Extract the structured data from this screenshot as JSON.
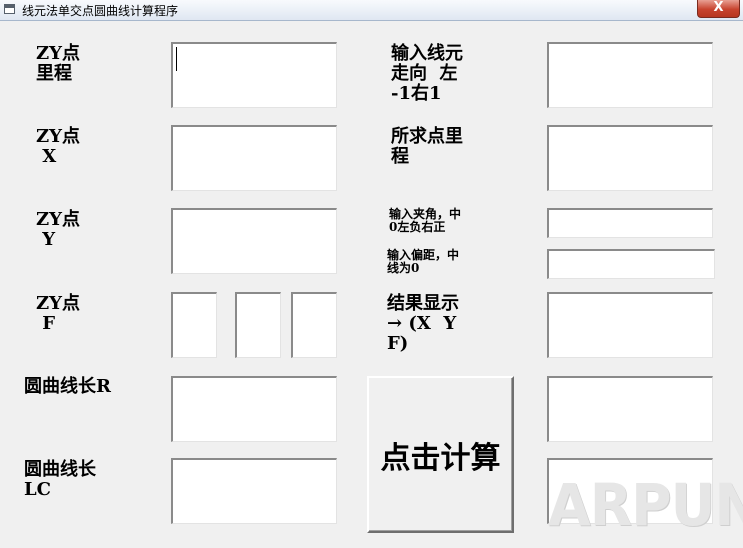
{
  "window": {
    "title": "线元法单交点圆曲线计算程序",
    "close_glyph": "X"
  },
  "labels": {
    "zy_mileage": "ZY点\n里程",
    "zy_x": "ZY点\n X",
    "zy_y": "ZY点\n Y",
    "zy_f": "ZY点\n F",
    "curve_r": "圆曲线长R",
    "curve_lc": "圆曲线长\nLC",
    "line_direction": "输入线元\n走向  左\n-1右1",
    "target_mileage": "所求点里\n程",
    "angle": "输入夹角，中\n0左负右正",
    "offset": "输入偏距，中\n线为0",
    "result": "结果显示\n→ (X  Y\nF)"
  },
  "buttons": {
    "calculate": "点击计算"
  },
  "fields": {
    "zy_mileage": "",
    "zy_x": "",
    "zy_y": "",
    "zy_f_deg": "",
    "zy_f_min": "",
    "zy_f_sec": "",
    "curve_r": "",
    "curve_lc": "",
    "line_direction": "",
    "target_mileage": "",
    "angle": "",
    "offset": "",
    "result_x": "",
    "result_y": "",
    "result_f": ""
  },
  "watermark": "ARPUN"
}
